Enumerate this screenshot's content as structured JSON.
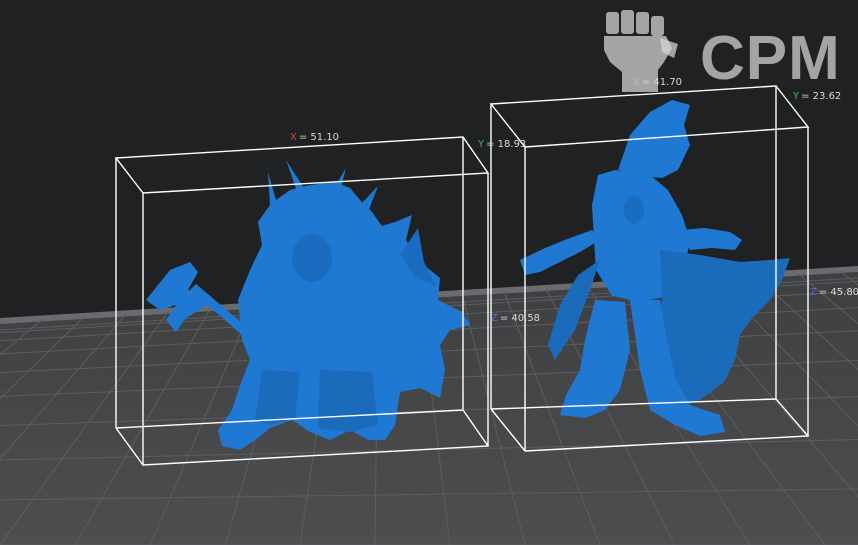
{
  "viewport": {
    "background_color": "#1f2123",
    "bed_color": "#4a4b4d",
    "grid_color": "#5c5d60",
    "model_color": "#1f78d1",
    "bounding_box_color": "#ffffff"
  },
  "models": [
    {
      "name": "barbarian-axe-figure",
      "dimensions": {
        "x_axis": "X",
        "x_value": "= 51.10",
        "y_axis": "Y",
        "y_value": "= 18.93",
        "z_axis": "Z",
        "z_value": "= 40.58"
      }
    },
    {
      "name": "sorceress-cloak-figure",
      "dimensions": {
        "x_axis": "X",
        "x_value": "= 41.70",
        "y_axis": "Y",
        "y_value": "= 23.62",
        "z_axis": "Z",
        "z_value": "= 45.80"
      }
    }
  ],
  "watermark": {
    "text": "CPM",
    "icon": "raised-fist-icon",
    "color": "#d7d7d7"
  }
}
